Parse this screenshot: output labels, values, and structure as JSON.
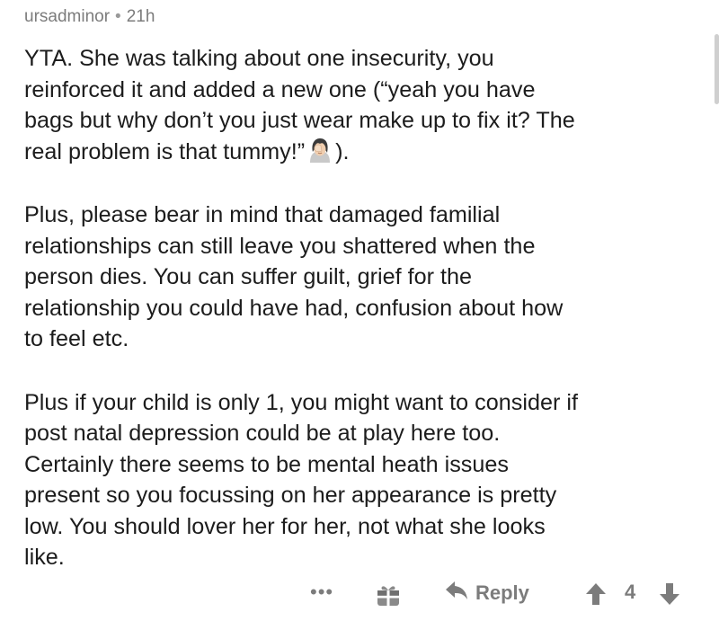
{
  "comment": {
    "author": "ursadminor",
    "separator": "•",
    "age": "21h",
    "paragraph1": {
      "lines": [
        "YTA. She was talking about one insecurity, you",
        "reinforced it and added a new one (“yeah you have",
        "bags but why don’t you just wear make up to fix it? The"
      ],
      "last_before_emoji": "real problem is that tummy!”",
      "last_after_emoji": ")."
    },
    "paragraph2": {
      "lines": [
        "Plus, please bear in mind that damaged familial",
        "relationships can still leave you shattered when the",
        "person dies. You can suffer guilt, grief for the",
        "relationship you could have had, confusion about how",
        "to feel etc."
      ]
    },
    "paragraph3": {
      "lines": [
        "Plus if your child is only 1, you might want to consider if",
        "post natal depression could be at play here too.",
        "Certainly there seems to be mental heath issues",
        "present so you focussing on her appearance is pretty",
        "low. You should lover her for her, not what she looks",
        "like."
      ]
    },
    "emoji": "facepalm-woman-icon"
  },
  "actions": {
    "more_label": "•••",
    "reply_label": "Reply",
    "score": "4"
  },
  "colors": {
    "text": "#1c1c1c",
    "muted": "#7c7c7c",
    "background": "#ffffff"
  }
}
